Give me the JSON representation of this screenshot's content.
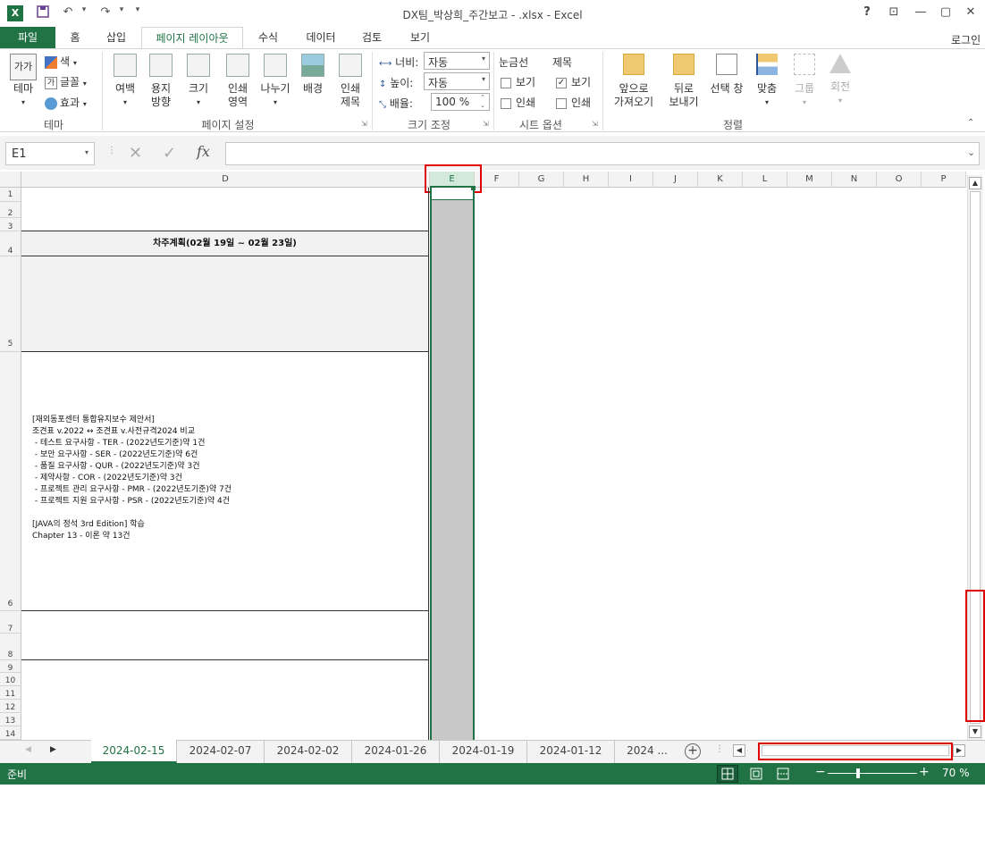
{
  "window": {
    "title": "DX팀_박상희_주간보고 - .xlsx - Excel",
    "help": "?",
    "minimize": "—",
    "restore": "▢",
    "close": "✕",
    "ribbon_options": "⊡"
  },
  "qat": {
    "app_icon": "X",
    "save_icon": "💾",
    "undo": "↶",
    "redo": "↷",
    "customize": "▾"
  },
  "ribbon_tabs": [
    "파일",
    "홈",
    "삽입",
    "페이지 레이아웃",
    "수식",
    "데이터",
    "검토",
    "보기"
  ],
  "account": "로그인",
  "ribbon": {
    "theme": {
      "theme_btn": "테마",
      "colors": "색",
      "fonts": "글꼴",
      "effects": "효과",
      "label": "테마"
    },
    "page_setup": {
      "margins": "여백",
      "orientation": "용지\n방향",
      "size": "크기",
      "print_area": "인쇄\n영역",
      "breaks": "나누기",
      "background": "배경",
      "print_titles": "인쇄\n제목",
      "label": "페이지 설정"
    },
    "scale": {
      "width_label": "너비:",
      "width_value": "자동",
      "height_label": "높이:",
      "height_value": "자동",
      "scale_label": "배율:",
      "scale_value": "100 %",
      "label": "크기 조정"
    },
    "sheet_options": {
      "gridlines": "눈금선",
      "headings": "제목",
      "view": "보기",
      "print": "인쇄",
      "gridlines_view": false,
      "gridlines_print": false,
      "headings_view": true,
      "headings_print": false,
      "label": "시트 옵션"
    },
    "arrange": {
      "bring_forward": "앞으로\n가져오기",
      "send_backward": "뒤로\n보내기",
      "selection_pane": "선택 창",
      "align": "맞춤",
      "group": "그룹",
      "rotate": "회전",
      "label": "정렬"
    }
  },
  "formula_bar": {
    "name_box": "E1",
    "cancel": "✕",
    "enter": "✓",
    "fx": "fx",
    "value": ""
  },
  "columns": [
    "D",
    "E",
    "F",
    "G",
    "H",
    "I",
    "J",
    "K",
    "L",
    "M",
    "N",
    "O",
    "P"
  ],
  "rows": [
    "1",
    "2",
    "3",
    "4",
    "5",
    "6",
    "7",
    "8",
    "9",
    "10",
    "11",
    "12",
    "13",
    "14"
  ],
  "cells": {
    "D4": "차주계획(02월 19일 ~ 02월 23일)",
    "D6": "[재외동포센터 통합유지보수 제안서]\n조견표 v.2022 ↔ 조견표 v.사전규격2024 비교\n - 테스트 요구사항 - TER - (2022년도기준)약 1건\n - 보안 요구사항 - SER - (2022년도기준)약 6건\n - 품질 요구사항 - QUR - (2022년도기준)약 3건\n - 제약사항 - COR - (2022년도기준)약 3건\n - 프로젝트 관리 요구사항 - PMR - (2022년도기준)약 7건\n - 프로젝트 지원 요구사항 - PSR - (2022년도기준)약 4건\n\n[JAVA의 정석 3rd Edition] 학습\nChapter 13 - 이론 약 13건"
  },
  "sheet_tabs": [
    "2024-02-15",
    "2024-02-07",
    "2024-02-02",
    "2024-01-26",
    "2024-01-19",
    "2024-01-12",
    "2024 ..."
  ],
  "active_sheet": "2024-02-15",
  "status": {
    "ready": "준비",
    "zoom": "70 %",
    "minus": "−",
    "plus": "+"
  },
  "colors": {
    "excel_green": "#217346",
    "highlight_red": "#e00000",
    "selected_col": "#c8c8c8"
  }
}
